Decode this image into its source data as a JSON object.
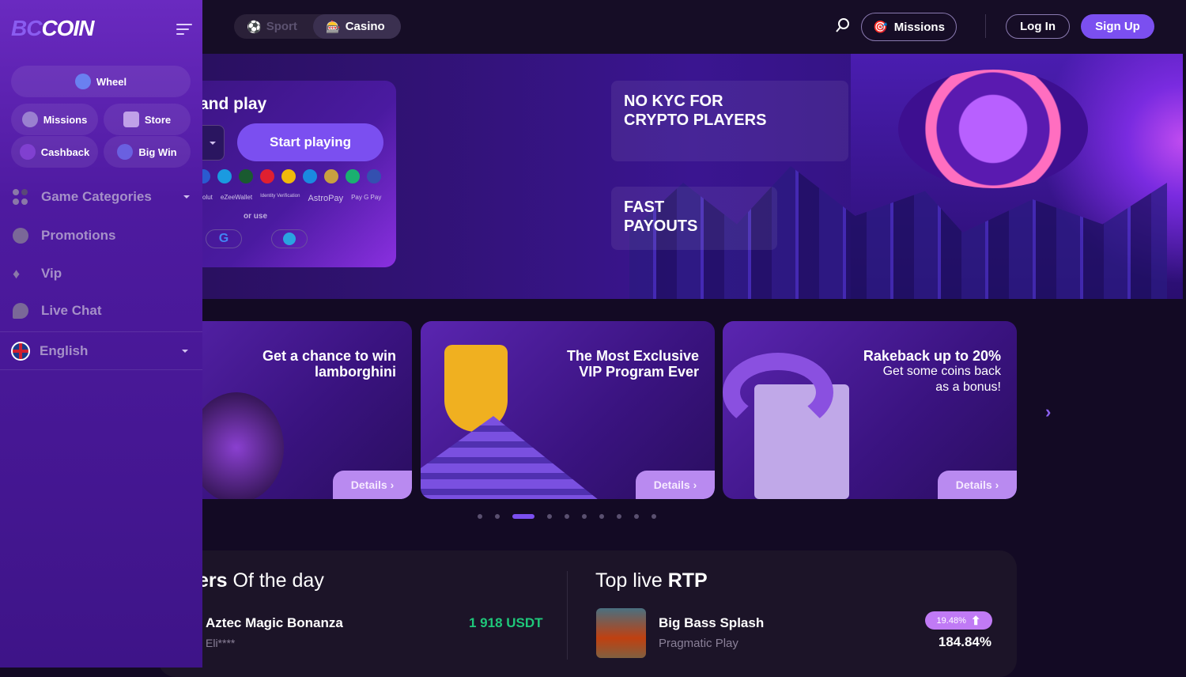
{
  "header": {
    "sport": "Sport",
    "casino": "Casino",
    "missions": "Missions",
    "login": "Log In",
    "signup": "Sign Up"
  },
  "sidebar": {
    "logo": "BCCOIN",
    "wheel": "Wheel",
    "missions": "Missions",
    "store": "Store",
    "cashback": "Cashback",
    "bigwin": "Big Win",
    "nav": [
      {
        "label": "Game Categories"
      },
      {
        "label": "Promotions"
      },
      {
        "label": "Vip"
      },
      {
        "label": "Live Chat"
      }
    ],
    "language": "English"
  },
  "hero": {
    "register_title": "and play",
    "start": "Start playing",
    "payments": [
      "olut",
      "eZeeWallet",
      "Identity Verification",
      "AstroPay",
      "Pay G Pay"
    ],
    "or_use": "or use",
    "banner1": "NO KYC FOR CRYPTO PLAYERS",
    "banner2": "FAST PAYOUTS"
  },
  "promos": [
    {
      "title": "Get a chance to win lamborghini",
      "details": "Details ›"
    },
    {
      "title": "The Most Exclusive VIP Program Ever",
      "details": "Details ›"
    },
    {
      "title": "Rakeback up to 20%",
      "subtitle": "Get some coins back as a bonus!",
      "details": "Details ›"
    }
  ],
  "carousel": {
    "dots": 10,
    "active": 2
  },
  "winners": {
    "title_bold": "ers",
    "title_rest": " Of the day",
    "game": "Aztec Magic Bonanza",
    "user": "Eli****",
    "amount": "1 918 USDT"
  },
  "rtp": {
    "title_light": "Top live ",
    "title_bold": "RTP",
    "game": "Big Bass Splash",
    "provider": "Pragmatic Play",
    "badge": "19.48%",
    "value": "184.84%"
  },
  "colors": {
    "accent": "#7b4ff0",
    "green": "#1fc77a",
    "badge": "#c07af5"
  }
}
